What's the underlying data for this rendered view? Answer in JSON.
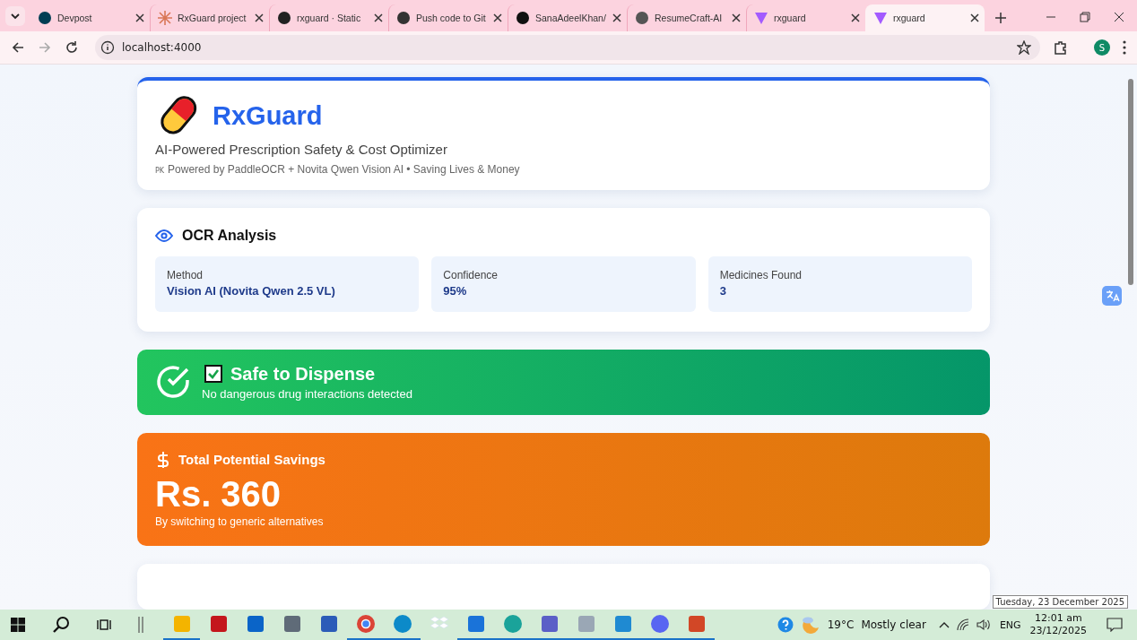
{
  "browser": {
    "tabs": [
      {
        "title": "Devpost",
        "selected": false
      },
      {
        "title": "RxGuard project",
        "selected": false
      },
      {
        "title": "rxguard · Static",
        "selected": false
      },
      {
        "title": "Push code to Git",
        "selected": false
      },
      {
        "title": "SanaAdeelKhan/",
        "selected": false
      },
      {
        "title": "ResumeCraft-AI",
        "selected": false
      },
      {
        "title": "rxguard",
        "selected": false
      },
      {
        "title": "rxguard",
        "selected": true
      }
    ],
    "address": "localhost:4000",
    "profile": "S"
  },
  "header": {
    "title": "RxGuard",
    "subtitle": "AI-Powered Prescription Safety & Cost Optimizer",
    "flag": "PK",
    "powered": "Powered by PaddleOCR + Novita Qwen Vision AI • Saving Lives & Money"
  },
  "ocr": {
    "title": "OCR Analysis",
    "stats": [
      {
        "label": "Method",
        "value": "Vision AI (Novita Qwen 2.5 VL)"
      },
      {
        "label": "Confidence",
        "value": "95%"
      },
      {
        "label": "Medicines Found",
        "value": "3"
      }
    ]
  },
  "safety": {
    "safe": true,
    "title": "Safe to Dispense",
    "message": "No dangerous drug interactions detected"
  },
  "savings": {
    "title": "Total Potential Savings",
    "amount": "Rs. 360",
    "note": "By switching to generic alternatives"
  },
  "taskbar": {
    "apps": [
      {
        "kind": "explorer",
        "running": true
      },
      {
        "kind": "acrobat",
        "running": false
      },
      {
        "kind": "outlook",
        "running": false
      },
      {
        "kind": "calculator",
        "running": false
      },
      {
        "kind": "word",
        "running": false
      },
      {
        "kind": "chrome",
        "running": true
      },
      {
        "kind": "edge",
        "running": true
      },
      {
        "kind": "dropbox",
        "running": false
      },
      {
        "kind": "outlooknew",
        "running": true
      },
      {
        "kind": "wave",
        "running": true
      },
      {
        "kind": "teams",
        "running": true
      },
      {
        "kind": "monitor",
        "running": true
      },
      {
        "kind": "vscode",
        "running": true
      },
      {
        "kind": "discord",
        "running": true
      },
      {
        "kind": "powerpoint",
        "running": true
      }
    ],
    "temperature": "19°C",
    "weather": "Mostly clear",
    "language": "ENG",
    "time": "12:01 am",
    "date": "23/12/2025",
    "tooltip": "Tuesday, 23 December 2025"
  }
}
